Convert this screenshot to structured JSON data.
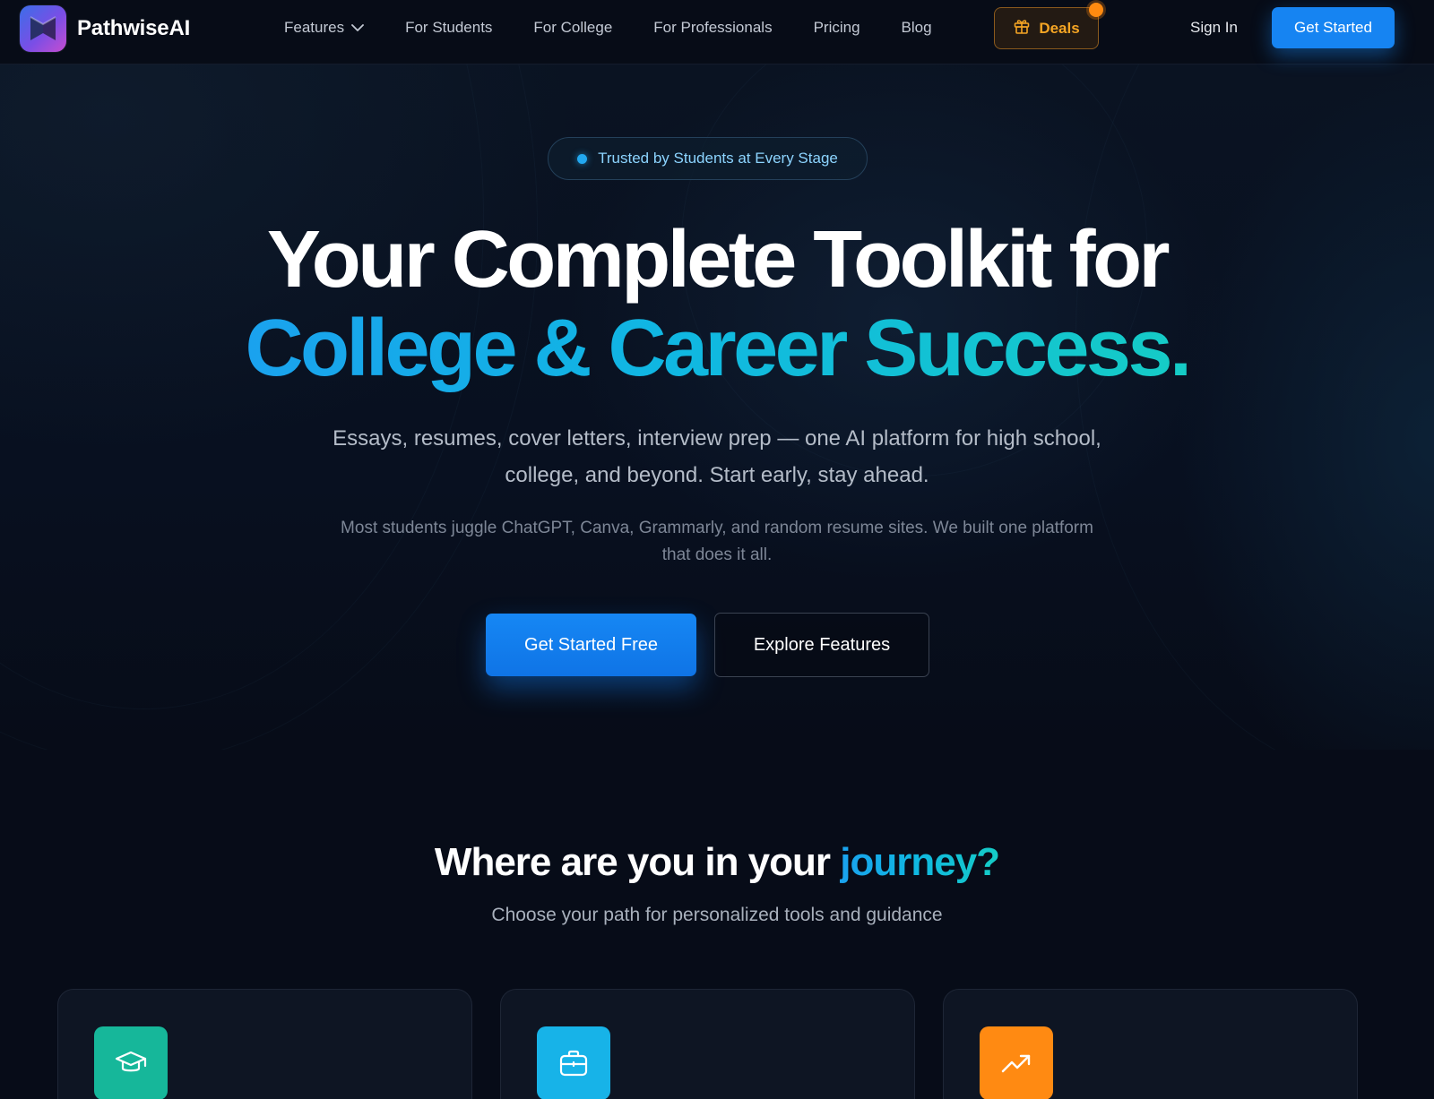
{
  "brand": {
    "name": "PathwiseAI"
  },
  "nav": {
    "links": [
      {
        "label": "Features",
        "has_dropdown": true
      },
      {
        "label": "For Students"
      },
      {
        "label": "For College"
      },
      {
        "label": "For Professionals"
      },
      {
        "label": "Pricing"
      },
      {
        "label": "Blog"
      }
    ],
    "deals_label": "Deals",
    "signin_label": "Sign In",
    "get_started_label": "Get Started"
  },
  "hero": {
    "badge": "Trusted by Students at Every Stage",
    "headline_line1": "Your Complete Toolkit for",
    "headline_line2": "College & Career Success.",
    "subtitle": "Essays, resumes, cover letters, interview prep — one AI platform for high school, college, and beyond. Start early, stay ahead.",
    "subtext": "Most students juggle ChatGPT, Canva, Grammarly, and random resume sites. We built one platform that does it all.",
    "cta_primary": "Get Started Free",
    "cta_secondary": "Explore Features"
  },
  "journey": {
    "title_prefix": "Where are you in your ",
    "title_highlight": "journey?",
    "subtitle": "Choose your path for personalized tools and guidance",
    "cards": [
      {
        "icon": "graduation-cap-icon",
        "color": "#16b79a"
      },
      {
        "icon": "briefcase-icon",
        "color": "#17b3e8"
      },
      {
        "icon": "trending-up-icon",
        "color": "#ff8a12"
      }
    ]
  },
  "colors": {
    "accent_blue": "#1684f2",
    "gradient_start": "#1aa2ee",
    "gradient_end": "#15ccc6",
    "deals_orange": "#f5a524",
    "background": "#070c18"
  }
}
